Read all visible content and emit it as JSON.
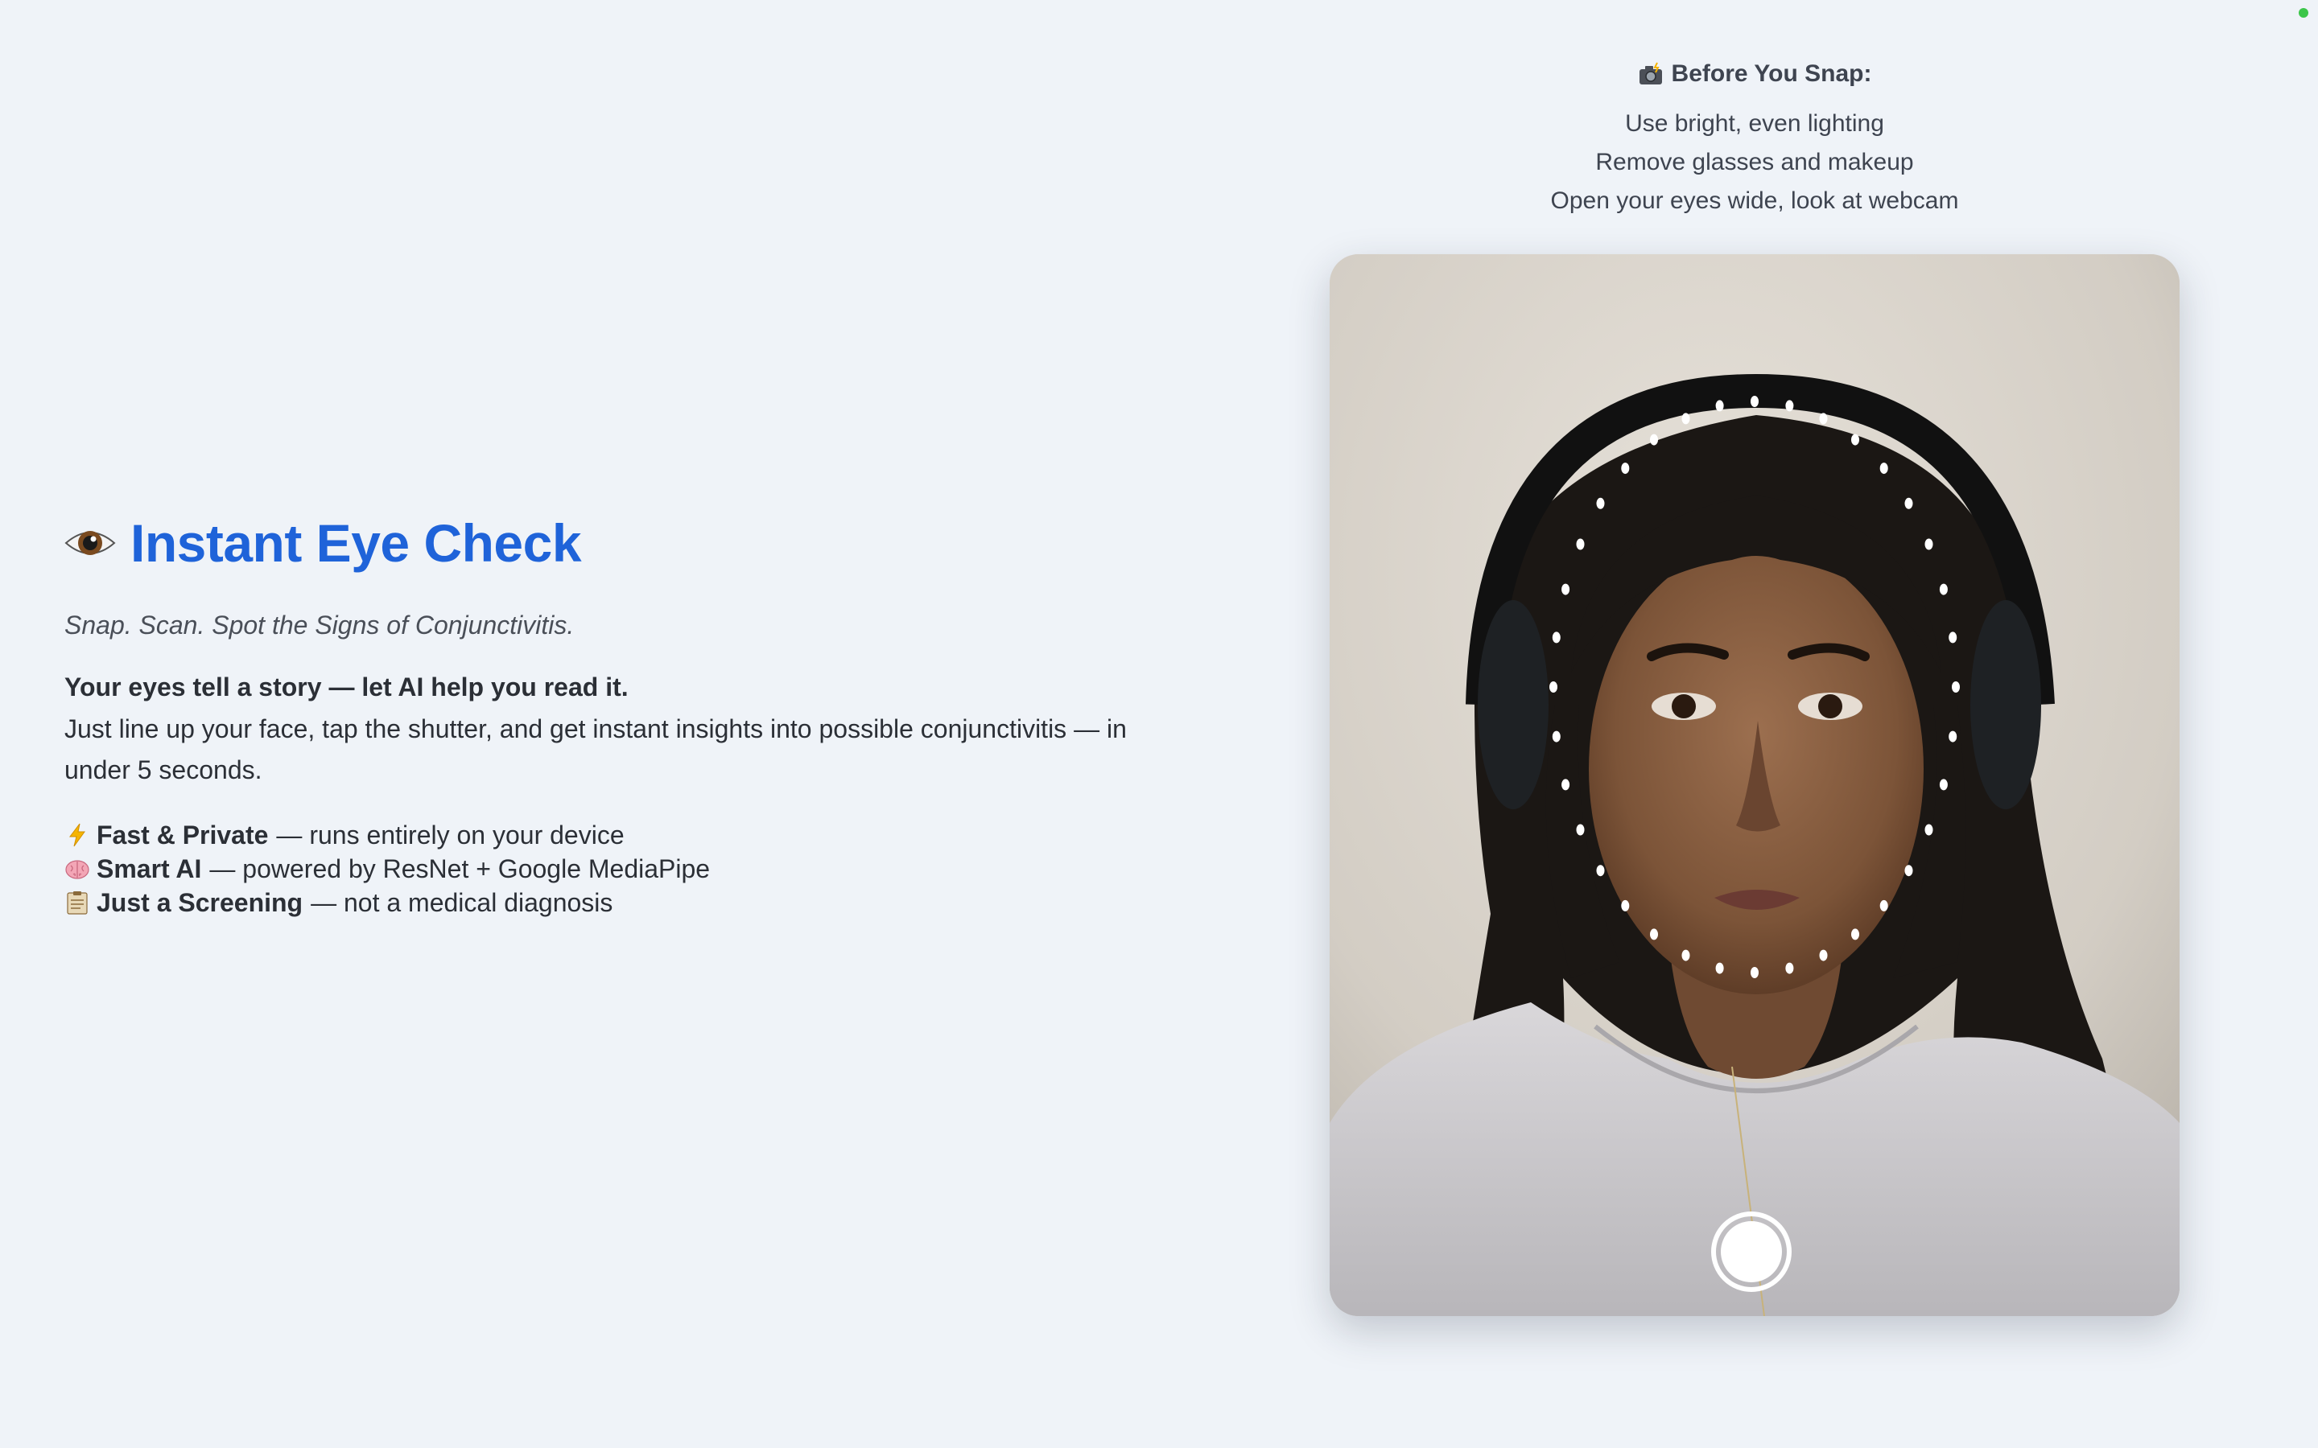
{
  "hero": {
    "eye_icon": "eye-emoji",
    "title": "Instant Eye Check",
    "tagline": "Snap. Scan. Spot the Signs of Conjunctivitis.",
    "story_headline": "Your eyes tell a story — let AI help you read it.",
    "story_body": "Just line up your face, tap the shutter, and get instant insights into possible conjunctivitis — in under 5 seconds."
  },
  "features": [
    {
      "icon": "lightning-emoji",
      "title": "Fast & Private",
      "desc": "— runs entirely on your device"
    },
    {
      "icon": "brain-emoji",
      "title": "Smart AI",
      "desc": "— powered by ResNet + Google MediaPipe"
    },
    {
      "icon": "clipboard-emoji",
      "title": "Just a Screening",
      "desc": "— not a medical diagnosis"
    }
  ],
  "tips": {
    "icon": "camera-flash-emoji",
    "heading": "Before You Snap:",
    "items": [
      "Use bright, even lighting",
      "Remove glasses and makeup",
      "Open your eyes wide, look at webcam"
    ]
  },
  "camera": {
    "shutter_label": "shutter-button",
    "face_guide": "face-landmark-oval"
  },
  "colors": {
    "title": "#1f63d9",
    "background": "#eff3f8",
    "status_dot": "#3cc64a"
  }
}
